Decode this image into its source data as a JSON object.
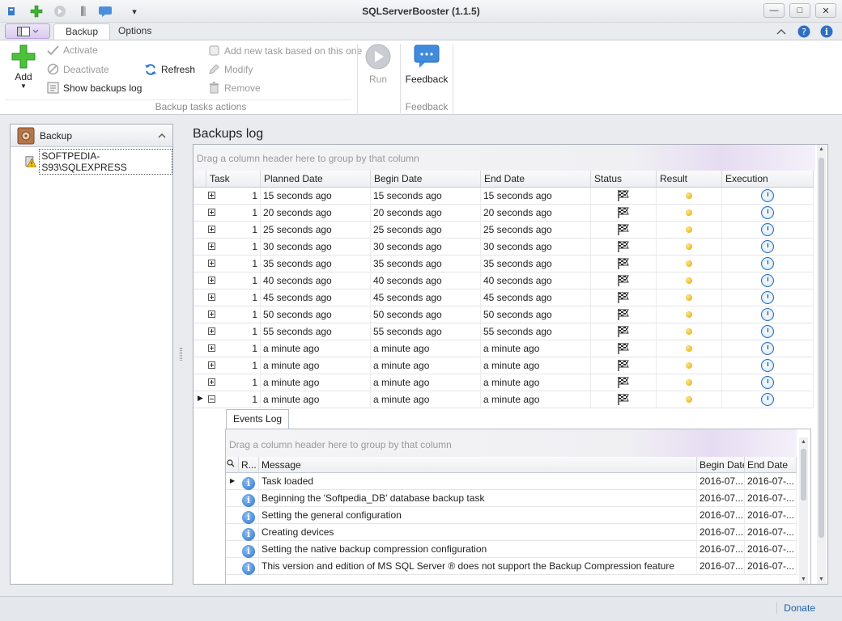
{
  "window": {
    "title": "SQLServerBooster (1.1.5)",
    "minimize_glyph": "—",
    "maximize_glyph": "□",
    "close_glyph": "✕",
    "qa_dropdown_glyph": "▾"
  },
  "tabs": [
    {
      "label": "Backup",
      "active": true
    },
    {
      "label": "Options",
      "active": false
    }
  ],
  "ribbon": {
    "add_label": "Add",
    "activate_label": "Activate",
    "deactivate_label": "Deactivate",
    "show_log_label": "Show backups log",
    "refresh_label": "Refresh",
    "add_based_label": "Add new task based on this one",
    "modify_label": "Modify",
    "remove_label": "Remove",
    "run_label": "Run",
    "feedback_label": "Feedback",
    "group_backup_actions": "Backup tasks actions",
    "group_feedback": "Feedback"
  },
  "left_panel": {
    "header": "Backup",
    "server": "SOFTPEDIA-S93\\SQLEXPRESS"
  },
  "main": {
    "title": "Backups log",
    "group_hint": "Drag a column header here to group by that column",
    "columns": [
      "Task",
      "Planned Date",
      "Begin Date",
      "End Date",
      "Status",
      "Result",
      "Execution"
    ],
    "rows": [
      {
        "task": "1",
        "planned": "15 seconds ago",
        "begin": "15 seconds ago",
        "end": "15 seconds ago"
      },
      {
        "task": "1",
        "planned": "20 seconds ago",
        "begin": "20 seconds ago",
        "end": "20 seconds ago"
      },
      {
        "task": "1",
        "planned": "25 seconds ago",
        "begin": "25 seconds ago",
        "end": "25 seconds ago"
      },
      {
        "task": "1",
        "planned": "30 seconds ago",
        "begin": "30 seconds ago",
        "end": "30 seconds ago"
      },
      {
        "task": "1",
        "planned": "35 seconds ago",
        "begin": "35 seconds ago",
        "end": "35 seconds ago"
      },
      {
        "task": "1",
        "planned": "40 seconds ago",
        "begin": "40 seconds ago",
        "end": "40 seconds ago"
      },
      {
        "task": "1",
        "planned": "45 seconds ago",
        "begin": "45 seconds ago",
        "end": "45 seconds ago"
      },
      {
        "task": "1",
        "planned": "50 seconds ago",
        "begin": "50 seconds ago",
        "end": "50 seconds ago"
      },
      {
        "task": "1",
        "planned": "55 seconds ago",
        "begin": "55 seconds ago",
        "end": "55 seconds ago"
      },
      {
        "task": "1",
        "planned": "a minute ago",
        "begin": "a minute ago",
        "end": "a minute ago"
      },
      {
        "task": "1",
        "planned": "a minute ago",
        "begin": "a minute ago",
        "end": "a minute ago"
      },
      {
        "task": "1",
        "planned": "a minute ago",
        "begin": "a minute ago",
        "end": "a minute ago"
      },
      {
        "task": "1",
        "planned": "a minute ago",
        "begin": "a minute ago",
        "end": "a minute ago",
        "expanded": true
      }
    ]
  },
  "events": {
    "tab_label": "Events Log",
    "group_hint": "Drag a column header here to group by that column",
    "columns": [
      "R...",
      "Message",
      "Begin Date",
      "End Date"
    ],
    "rows": [
      {
        "message": "Task loaded",
        "begin": "2016-07...",
        "end": "2016-07-..."
      },
      {
        "message": "Beginning the 'Softpedia_DB' database backup task",
        "begin": "2016-07...",
        "end": "2016-07-..."
      },
      {
        "message": "Setting the general configuration",
        "begin": "2016-07...",
        "end": "2016-07-..."
      },
      {
        "message": "Creating devices",
        "begin": "2016-07...",
        "end": "2016-07-..."
      },
      {
        "message": "Setting the native backup compression configuration",
        "begin": "2016-07...",
        "end": "2016-07-..."
      },
      {
        "message": "This version and edition of MS SQL Server ® does not support the Backup Compression feature",
        "begin": "2016-07...",
        "end": "2016-07-..."
      }
    ]
  },
  "statusbar": {
    "donate_label": "Donate"
  }
}
